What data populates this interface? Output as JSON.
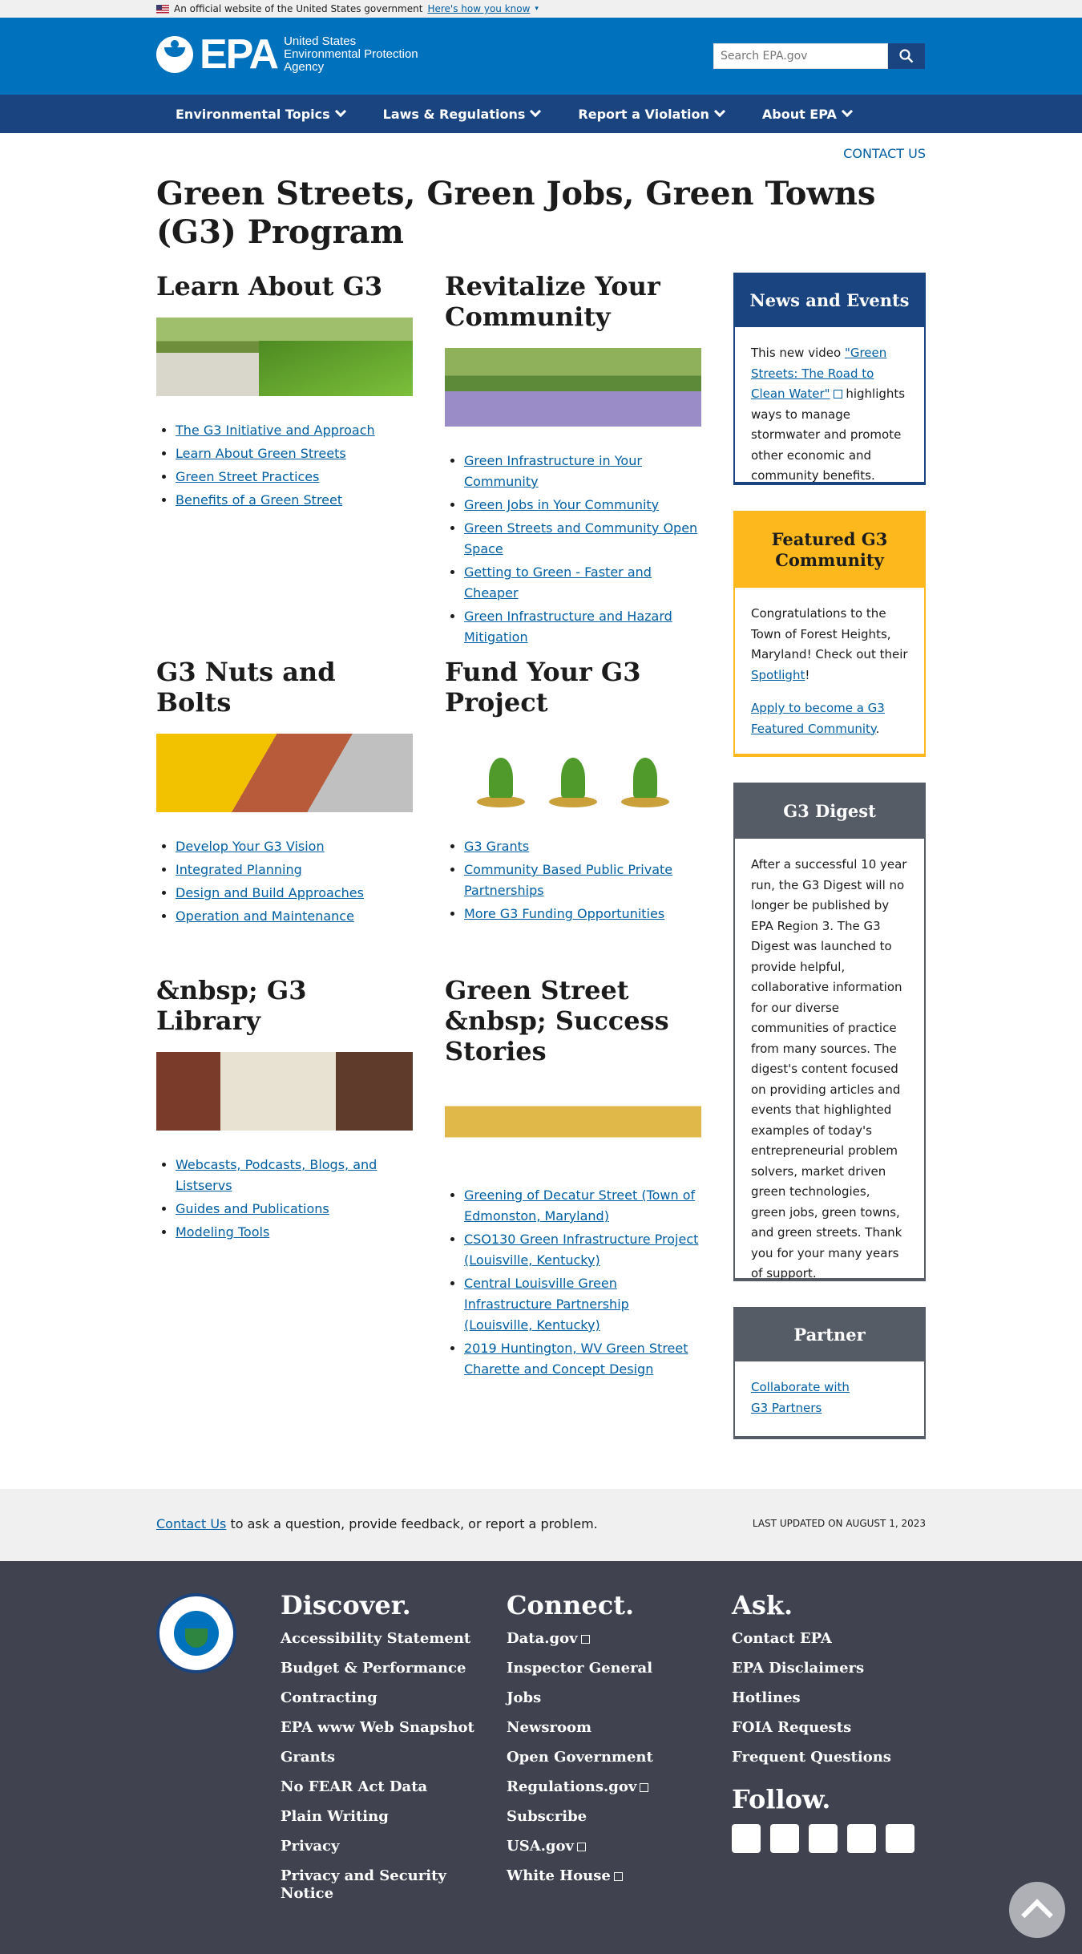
{
  "banner": {
    "text": "An official website of the United States government",
    "link": "Here's how you know"
  },
  "header": {
    "logo_epa": "EPA",
    "logo_line1": "United States",
    "logo_line2": "Environmental Protection",
    "logo_line3": "Agency",
    "search_placeholder": "Search EPA.gov"
  },
  "nav": [
    "Environmental Topics",
    "Laws & Regulations",
    "Report a Violation",
    "About EPA"
  ],
  "contact_top": "Contact Us",
  "page_title": "Green Streets, Green Jobs, Green Towns (G3) Program",
  "sections": [
    {
      "title": "Learn About G3",
      "links": [
        "The G3 Initiative and Approach",
        "Learn About Green Streets",
        "Green Street Practices",
        "Benefits of a Green Street"
      ]
    },
    {
      "title": "Revitalize Your Community",
      "links": [
        "Green Infrastructure in Your Community",
        "Green Jobs in Your Community",
        "Green Streets and Community Open Space",
        "Getting to Green - Faster and Cheaper",
        "Green Infrastructure and Hazard Mitigation"
      ]
    },
    {
      "title": "G3 Nuts and Bolts",
      "links": [
        "Develop Your G3 Vision",
        "Integrated Planning",
        "Design and Build Approaches",
        "Operation and Maintenance"
      ]
    },
    {
      "title": "Fund Your G3 Project",
      "links": [
        "G3 Grants",
        "Community Based Public Private Partnerships",
        "More G3 Funding Opportunities"
      ]
    },
    {
      "title": "&nbsp; G3 Library",
      "links": [
        "Webcasts, Podcasts, Blogs, and Listservs",
        "Guides and Publications",
        "Modeling Tools"
      ]
    },
    {
      "title": "Green Street &nbsp; Success Stories",
      "links": [
        "Greening of Decatur Street (Town of Edmonston, Maryland)",
        "CSO130 Green Infrastructure Project (Louisville, Kentucky)",
        "Central Louisville Green Infrastructure Partnership (Louisville, Kentucky)",
        "2019 Huntington, WV Green Street Charette and Concept Design "
      ]
    }
  ],
  "sidebar": {
    "news": {
      "title": "News and Events",
      "pre": "This new video ",
      "link": "\"Green Streets: The Road to Clean Water\"",
      "post": " highlights ways to manage stormwater and promote other economic and community benefits."
    },
    "featured": {
      "title": "Featured G3 Community",
      "pre": "Congratulations to the Town of Forest Heights, Maryland!  Check out their ",
      "link": "Spotlight",
      "post": "!",
      "apply_link": "Apply to become a G3 Featured Community",
      "apply_post": "."
    },
    "digest": {
      "title": "G3 Digest",
      "body": "After a successful 10 year run, the G3 Digest will no longer be published by EPA Region 3.  The G3 Digest was launched to provide helpful, collaborative information for our diverse communities of practice from many sources.  The digest's content focused on providing articles and events  that highlighted examples of today's entrepreneurial problem solvers, market driven green technologies, green jobs, green towns, and green streets. Thank you for your many years of support."
    },
    "partner": {
      "title": "Partner",
      "link_line1": "Collaborate with",
      "link_line2": "G3 Partners"
    }
  },
  "contact_band": {
    "link": "Contact Us",
    "text": " to ask a question, provide feedback, or report a problem.",
    "updated": "Last updated on August 1, 2023"
  },
  "footer": {
    "discover": {
      "title": "Discover.",
      "items": [
        "Accessibility Statement",
        "Budget & Performance",
        "Contracting",
        "EPA www Web Snapshot",
        "Grants",
        "No FEAR Act Data",
        "Plain Writing",
        "Privacy",
        "Privacy and Security Notice"
      ]
    },
    "connect": {
      "title": "Connect.",
      "items": [
        "Data.gov",
        "Inspector General",
        "Jobs",
        "Newsroom",
        "Open Government",
        "Regulations.gov",
        "Subscribe",
        "USA.gov",
        "White House"
      ]
    },
    "ask": {
      "title": "Ask.",
      "items": [
        "Contact EPA",
        "EPA Disclaimers",
        "Hotlines",
        "FOIA Requests",
        "Frequent Questions"
      ]
    },
    "follow": {
      "title": "Follow.",
      "icons": [
        "facebook-icon",
        "twitter-icon",
        "youtube-icon",
        "flickr-icon",
        "instagram-icon"
      ]
    }
  },
  "colors": {
    "primary": "#0071bc",
    "nav": "#1a4480",
    "featured": "#fdb81e",
    "gray": "#565c65",
    "footer": "#40434f"
  }
}
